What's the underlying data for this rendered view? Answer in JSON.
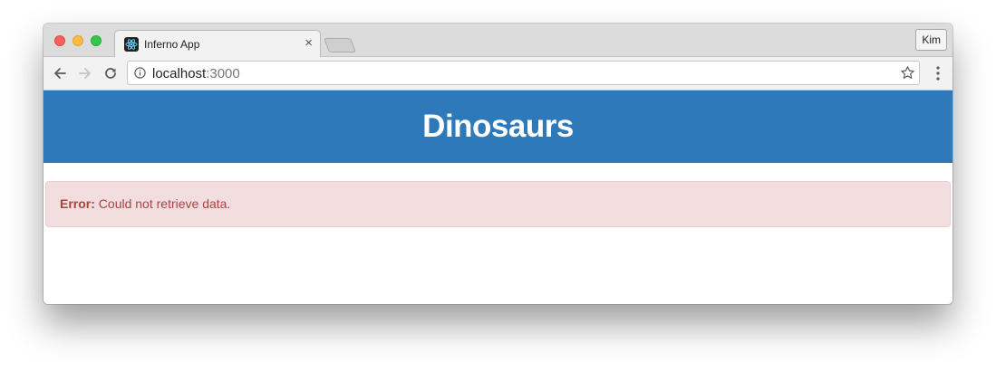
{
  "browser": {
    "tab": {
      "title": "Inferno App",
      "close_symbol": "×",
      "favicon": "atom-icon"
    },
    "profile_button": "Kim",
    "address_bar": {
      "host": "localhost",
      "port": ":3000"
    },
    "icons": [
      "back-arrow-icon",
      "forward-arrow-icon",
      "reload-icon",
      "info-icon",
      "star-icon",
      "menu-dots-icon"
    ]
  },
  "app": {
    "header_title": "Dinosaurs",
    "header_color": "#2e79ba",
    "alert": {
      "label": "Error:",
      "message": " Could not retrieve data.",
      "background": "#f2dede",
      "text_color": "#a94442"
    }
  }
}
